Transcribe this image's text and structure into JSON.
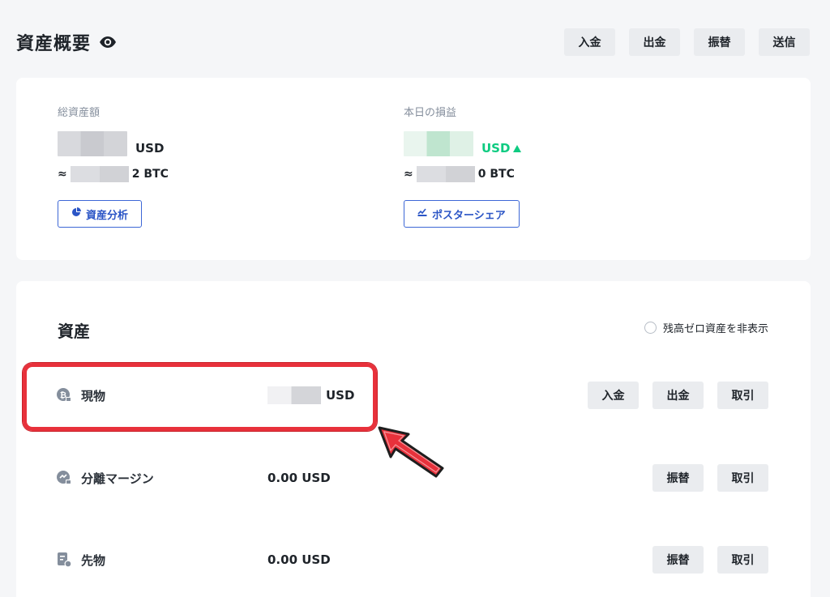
{
  "header": {
    "title": "資産概要",
    "actions": [
      "入金",
      "出金",
      "振替",
      "送信"
    ]
  },
  "summary": {
    "total": {
      "label": "総資産額",
      "unit": "USD",
      "btc_prefix": "≈",
      "btc_suffix": "2 BTC",
      "button": "資産分析"
    },
    "pnl": {
      "label": "本日の損益",
      "unit": "USD",
      "btc_prefix": "≈",
      "btc_suffix": "0 BTC",
      "button": "ポスターシェア"
    }
  },
  "assets": {
    "title": "資産",
    "hide_zero_label": "残高ゼロ資産を非表示",
    "rows": [
      {
        "name": "現物",
        "value": "USD",
        "actions": [
          "入金",
          "出金",
          "取引"
        ]
      },
      {
        "name": "分離マージン",
        "value": "0.00 USD",
        "actions": [
          "振替",
          "取引"
        ]
      },
      {
        "name": "先物",
        "value": "0.00 USD",
        "actions": [
          "振替",
          "取引"
        ]
      }
    ]
  },
  "colors": {
    "accent_blue": "#2b55c6",
    "profit_green": "#0ecb81",
    "highlight_red": "#e8313b"
  }
}
